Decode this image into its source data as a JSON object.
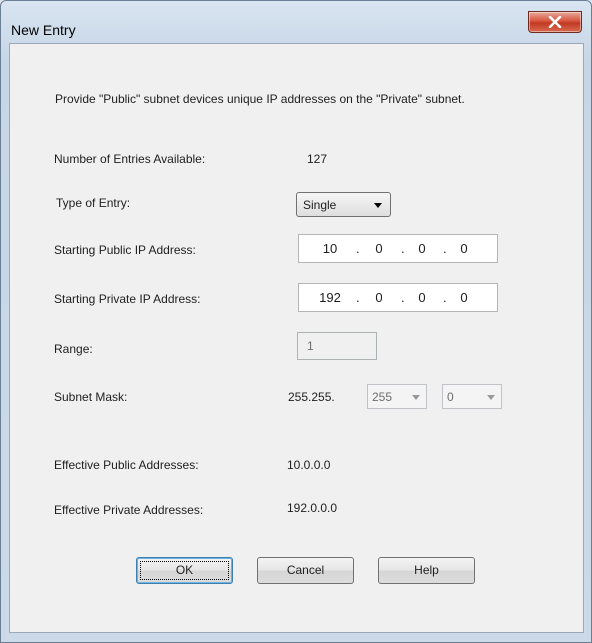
{
  "window": {
    "title": "New Entry",
    "close_icon": "close-icon"
  },
  "intro": "Provide \"Public\" subnet devices unique IP addresses on the \"Private\" subnet.",
  "fields": {
    "entries_available": {
      "label": "Number of Entries Available:",
      "value": "127"
    },
    "type_of_entry": {
      "label": "Type of Entry:",
      "value": "Single"
    },
    "start_public": {
      "label": "Starting Public IP Address:",
      "octets": [
        "10",
        "0",
        "0",
        "0"
      ]
    },
    "start_private": {
      "label": "Starting Private IP Address:",
      "octets": [
        "192",
        "0",
        "0",
        "0"
      ]
    },
    "range": {
      "label": "Range:",
      "value": "1"
    },
    "subnet_mask": {
      "label": "Subnet Mask:",
      "prefix": "255.255.",
      "octet3": "255",
      "octet4": "0"
    },
    "effective_public": {
      "label": "Effective Public Addresses:",
      "value": "10.0.0.0"
    },
    "effective_private": {
      "label": "Effective Private Addresses:",
      "value": "192.0.0.0"
    }
  },
  "buttons": {
    "ok": "OK",
    "cancel": "Cancel",
    "help": "Help"
  }
}
